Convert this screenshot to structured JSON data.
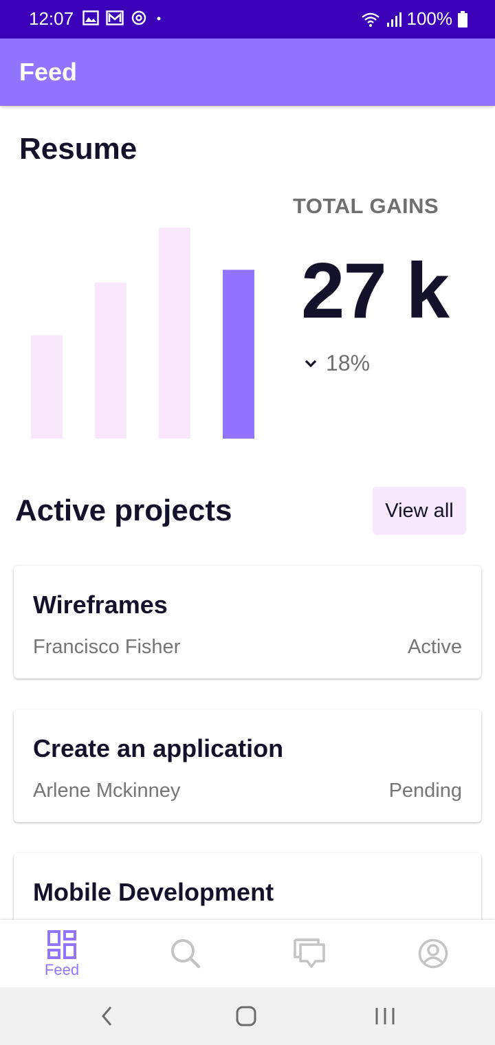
{
  "status_bar": {
    "time": "12:07",
    "battery": "100%",
    "left_icons": [
      "image-icon",
      "gmail-icon",
      "sync-icon",
      "dot-icon"
    ],
    "right_icons": [
      "wifi-icon",
      "signal-icon",
      "battery-icon"
    ]
  },
  "app_bar": {
    "title": "Feed",
    "background": "#9275ff"
  },
  "resume": {
    "title": "Resume",
    "gains_label": "TOTAL GAINS",
    "gains_value": "27 k",
    "change": "18%",
    "change_icon": "chevron-down-icon"
  },
  "chart_data": {
    "type": "bar",
    "values": [
      49,
      74,
      100,
      80
    ],
    "highlight_index": 3,
    "bar_color": "#f9e8fc",
    "highlight_color": "#9275ff"
  },
  "projects": {
    "title": "Active projects",
    "view_all": "View all",
    "items": [
      {
        "title": "Wireframes",
        "owner": "Francisco Fisher",
        "status": "Active"
      },
      {
        "title": "Create an application",
        "owner": "Arlene Mckinney",
        "status": "Pending"
      },
      {
        "title": "Mobile Development",
        "owner": "",
        "status": ""
      }
    ]
  },
  "bottom_nav": {
    "items": [
      {
        "label": "Feed",
        "icon": "dashboard-icon",
        "active": true
      },
      {
        "label": "",
        "icon": "search-icon",
        "active": false
      },
      {
        "label": "",
        "icon": "chat-icon",
        "active": false
      },
      {
        "label": "",
        "icon": "profile-icon",
        "active": false
      }
    ],
    "active_color": "#9275ff",
    "inactive_color": "#c4c4c4"
  },
  "system_nav": {
    "buttons": [
      "back-icon",
      "home-icon",
      "recents-icon"
    ]
  }
}
